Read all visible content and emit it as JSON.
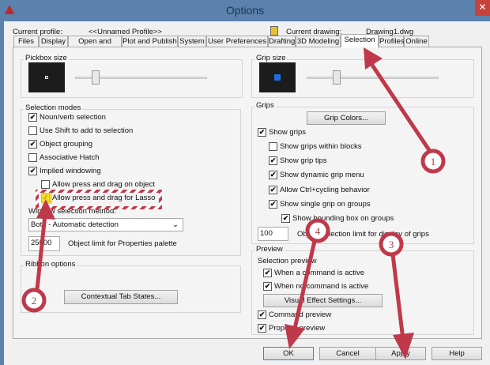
{
  "window": {
    "title": "Options",
    "close": "✕"
  },
  "profile": {
    "label": "Current profile:",
    "value": "<<Unnamed Profile>>",
    "drawing_label": "Current drawing:",
    "drawing_value": "Drawing1.dwg"
  },
  "tabs": [
    "Files",
    "Display",
    "Open and Save",
    "Plot and Publish",
    "System",
    "User Preferences",
    "Drafting",
    "3D Modeling",
    "Selection",
    "Profiles",
    "Online"
  ],
  "active_tab": "Selection",
  "pickbox": {
    "label": "Pickbox size",
    "slider_fraction": 0.15
  },
  "grip_size": {
    "label": "Grip size",
    "slider_fraction": 0.2,
    "grip_color": "#1e6fe0"
  },
  "selection_modes": {
    "label": "Selection modes",
    "items": [
      {
        "label": "Noun/verb selection",
        "checked": true
      },
      {
        "label": "Use Shift to add to selection",
        "checked": false
      },
      {
        "label": "Object grouping",
        "checked": true
      },
      {
        "label": "Associative Hatch",
        "checked": false
      },
      {
        "label": "Implied windowing",
        "checked": true
      },
      {
        "label": "Allow press and drag on object",
        "checked": false
      },
      {
        "label": "Allow press and drag for Lasso",
        "checked": true
      }
    ],
    "window_method_label": "Window selection method:",
    "window_method_value": "Both - Automatic detection",
    "limit_value": "25000",
    "limit_label": "Object limit for Properties palette"
  },
  "ribbon": {
    "label": "Ribbon options",
    "button": "Contextual Tab States..."
  },
  "grips": {
    "label": "Grips",
    "button": "Grip Colors...",
    "items": [
      {
        "label": "Show grips",
        "checked": true
      },
      {
        "label": "Show grips within blocks",
        "checked": false
      },
      {
        "label": "Show grip tips",
        "checked": true
      },
      {
        "label": "Show dynamic grip menu",
        "checked": true
      },
      {
        "label": "Allow Ctrl+cycling behavior",
        "checked": true
      },
      {
        "label": "Show single grip on groups",
        "checked": true
      },
      {
        "label": "Show bounding box on groups",
        "checked": true
      }
    ],
    "limit_value": "100",
    "limit_label": "Object selection limit for display of grips"
  },
  "preview": {
    "label": "Preview",
    "sel_label": "Selection preview",
    "items": [
      {
        "label": "When a command is active",
        "checked": true
      },
      {
        "label": "When no command is active",
        "checked": true
      },
      {
        "label": "Command preview",
        "checked": true
      },
      {
        "label": "Property preview",
        "checked": true
      }
    ],
    "button": "Visual Effect Settings..."
  },
  "buttons": {
    "ok": "OK",
    "cancel": "Cancel",
    "apply": "Apply",
    "help": "Help"
  },
  "annotations": {
    "color": "#c0394b",
    "markers": [
      "1",
      "2",
      "3",
      "4"
    ]
  }
}
